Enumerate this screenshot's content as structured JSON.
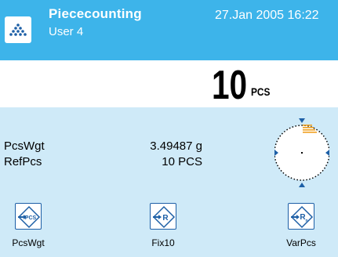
{
  "header": {
    "icon": "piececounting-dots-icon",
    "title": "Piececounting",
    "user": "User 4",
    "datetime": "27.Jan 2005  16:22"
  },
  "weight": {
    "value": "10",
    "unit": "PCS"
  },
  "info": {
    "rows": [
      {
        "label": "PcsWgt",
        "value": "3.49487 g"
      },
      {
        "label": "RefPcs",
        "value": "10 PCS"
      }
    ]
  },
  "softkeys": [
    {
      "label": "PcsWgt",
      "icon": "pcs-weight-key-icon",
      "glyph": "PCS"
    },
    {
      "label": "Fix10",
      "icon": "fix-reference-key-icon",
      "glyph": "R"
    },
    {
      "label": "VarPcs",
      "icon": "variable-reference-key-icon",
      "glyph": "R"
    }
  ],
  "colors": {
    "header": "#3db4ea",
    "panel": "#cfeaf8",
    "key_blue": "#1d5fa6",
    "gauge_marker": "#f0a020"
  }
}
